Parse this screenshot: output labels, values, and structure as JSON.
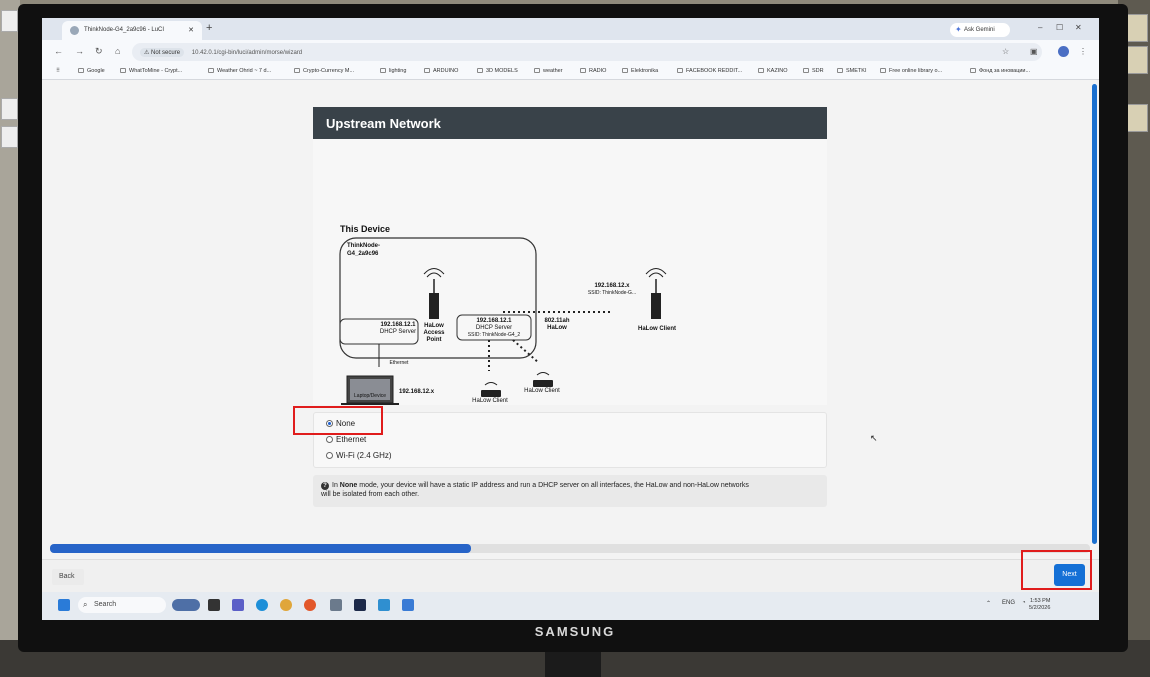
{
  "monitor": {
    "brand": "SAMSUNG"
  },
  "browser": {
    "tab_title": "ThinkNode-G4_2a9c96 - LuCI",
    "gemini_label": "Ask Gemini",
    "security_label": "Not secure",
    "url": "10.42.0.1/cgi-bin/luci/admin/morse/wizard",
    "bookmarks": [
      "Google",
      "WhatToMine - Crypt...",
      "Weather Ohrid ~ 7 d...",
      "Crypto-Currency M...",
      "lighting",
      "ARDUINO",
      "3D MODELS",
      "weather",
      "RADIO",
      "Elektronika",
      "FACEBOOK REDDIT...",
      "KAZINO",
      "SDR",
      "SMETKI",
      "Free online library o...",
      "Фонд за иновации..."
    ]
  },
  "wizard": {
    "section_title": "Upstream Network",
    "diagram": {
      "this_device": "This Device",
      "device_name_1": "ThinkNode-",
      "device_name_2": "G4_2a9c96",
      "dhcp_left_ip": "192.168.12.1",
      "dhcp_left_label": "DHCP Server",
      "ethernet": "Ethernet",
      "ap_1": "HaLow",
      "ap_2": "Access",
      "ap_3": "Point",
      "dhcp_right_ip": "192.168.12.1",
      "dhcp_right_label": "DHCP Server",
      "ssid_right": "SSID: ThinkNode-G4_2",
      "link_1": "802.11ah",
      "link_2": "HaLow",
      "remote_ip": "192.168.12.x",
      "remote_ssid": "SSID: ThinkNode-G...",
      "remote_client": "HaLow Client",
      "laptop_ip": "192.168.12.x",
      "laptop_label": "Laptop/Device",
      "client_a": "HaLow Client",
      "client_b": "HaLow Client"
    },
    "options": [
      {
        "label": "None",
        "selected": true
      },
      {
        "label": "Ethernet",
        "selected": false
      },
      {
        "label": "Wi-Fi (2.4 GHz)",
        "selected": false
      }
    ],
    "info_prefix": "In",
    "info_mode": "None",
    "info_line1": "mode, your device will have a static IP address and run a DHCP server on all interfaces, the HaLow and non-HaLow networks",
    "info_line2": "will be isolated from each other.",
    "progress_fraction": 0.405,
    "back_label": "Back",
    "next_label": "Next"
  },
  "taskbar": {
    "search_label": "Search",
    "lang": "ENG",
    "time": "1:53 PM",
    "date": "5/2/2026"
  },
  "colors": {
    "accent": "#1570d6",
    "header": "#394249",
    "annotation": "#e01c1c",
    "progress": "#2764c8"
  }
}
